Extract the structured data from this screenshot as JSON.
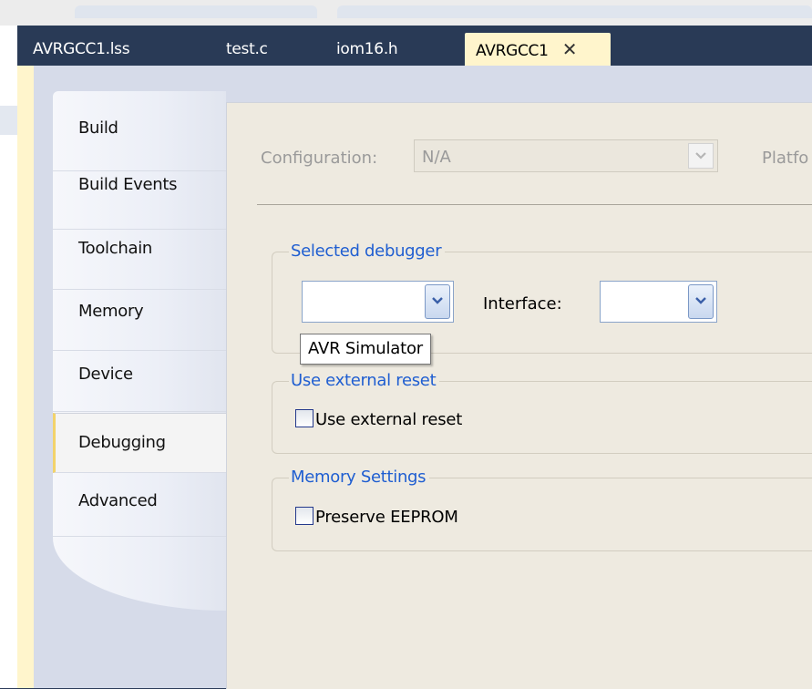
{
  "document_tabs": [
    {
      "label": "AVRGCC1.lss"
    },
    {
      "label": "test.c"
    },
    {
      "label": "iom16.h"
    },
    {
      "label": "AVRGCC1",
      "active": true
    }
  ],
  "close_glyph": "✕",
  "nav": {
    "items": [
      {
        "label": "Build"
      },
      {
        "label": "Build Events"
      },
      {
        "label": "Toolchain"
      },
      {
        "label": "Memory"
      },
      {
        "label": "Device"
      },
      {
        "label": "Debugging",
        "active": true
      },
      {
        "label": "Advanced"
      }
    ]
  },
  "configuration": {
    "label": "Configuration:",
    "value": "N/A",
    "platform_label": "Platfo"
  },
  "selected_debugger": {
    "title": "Selected debugger",
    "value": "",
    "tooltip": "AVR Simulator",
    "interface_label": "Interface:",
    "interface_value": ""
  },
  "external_reset": {
    "title": "Use external reset",
    "checkbox_label": "Use external reset",
    "checked": false
  },
  "memory_settings": {
    "title": "Memory Settings",
    "checkbox_label": "Preserve EEPROM",
    "checked": false
  },
  "colors": {
    "frame": "#2b3b58",
    "active_tab": "#fff5cc",
    "panel": "#eeeae0",
    "group_title": "#1f5ed1"
  },
  "icons": {
    "dropdown": "chevron-down-icon",
    "close": "close-icon"
  }
}
